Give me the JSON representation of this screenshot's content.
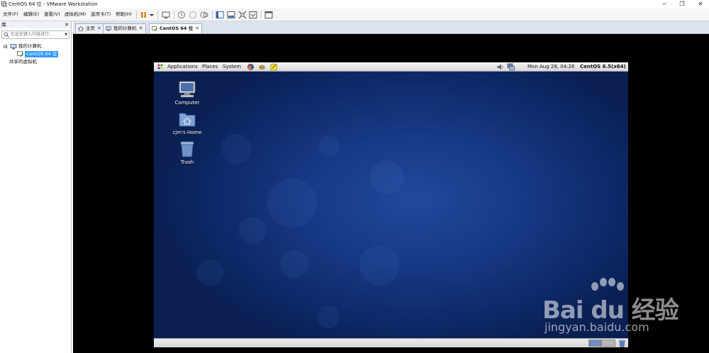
{
  "window": {
    "title": "CentOS 64 位 - VMware Workstation",
    "controls": {
      "minimize": "─",
      "restore": "❐",
      "close": "✕"
    }
  },
  "menu": [
    "文件(F)",
    "编辑(E)",
    "查看(V)",
    "虚拟机(M)",
    "选项卡(T)",
    "帮助(H)"
  ],
  "toolbar": {
    "buttons": [
      "pause-icon",
      "dropdown-icon",
      "send-ctrl-alt-del-icon",
      "snapshot-icon",
      "revert-snapshot-icon",
      "snapshot-manager-icon",
      "console-view-icon",
      "fullscreen-icon",
      "unity-icon",
      "stretch-icon",
      "thumbnail-icon"
    ]
  },
  "library": {
    "title": "库",
    "close": "✕",
    "search_placeholder": "在此处键入内容进行...",
    "tree": [
      {
        "label": "我的计算机",
        "expander": "⊟"
      },
      {
        "label": "CentOS 64 位",
        "selected": true
      },
      {
        "label": "共享的虚拟机"
      }
    ]
  },
  "tabs": [
    {
      "label": "主页",
      "close": "✕",
      "icon": "home-icon"
    },
    {
      "label": "我的计算机",
      "close": "✕",
      "icon": "computer-icon"
    },
    {
      "label": "CentOS 64 位",
      "close": "✕",
      "icon": "vm-icon",
      "active": true
    }
  ],
  "guest": {
    "panel_menus": [
      "Applications",
      "Places",
      "System"
    ],
    "clock": "Mon Aug 28, 04:26",
    "os_label": "CentOS 6.5(x64)",
    "desktop_icons": [
      "Computer",
      "cjm's Home",
      "Trash"
    ]
  },
  "watermark": {
    "brand": "Bai du 经验",
    "url": "jingyan.baidu.com"
  },
  "colors": {
    "selection": "#3399ff",
    "desktop_center": "#23489b",
    "desktop_edge": "#0a1f52",
    "vm_background": "#000000"
  }
}
